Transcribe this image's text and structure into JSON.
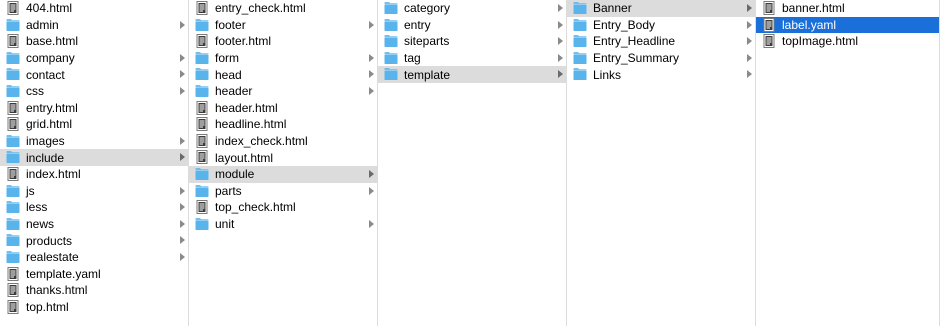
{
  "colors": {
    "folder": "#5ab4ec",
    "selection_active": "#1a6fd8",
    "selection_inactive": "#dcdcdc"
  },
  "columns": [
    {
      "name": "root",
      "items": [
        {
          "label": "404.html",
          "type": "file"
        },
        {
          "label": "admin",
          "type": "folder"
        },
        {
          "label": "base.html",
          "type": "file"
        },
        {
          "label": "company",
          "type": "folder"
        },
        {
          "label": "contact",
          "type": "folder"
        },
        {
          "label": "css",
          "type": "folder"
        },
        {
          "label": "entry.html",
          "type": "file"
        },
        {
          "label": "grid.html",
          "type": "file"
        },
        {
          "label": "images",
          "type": "folder"
        },
        {
          "label": "include",
          "type": "folder",
          "selected": "path"
        },
        {
          "label": "index.html",
          "type": "file"
        },
        {
          "label": "js",
          "type": "folder"
        },
        {
          "label": "less",
          "type": "folder"
        },
        {
          "label": "news",
          "type": "folder"
        },
        {
          "label": "products",
          "type": "folder"
        },
        {
          "label": "realestate",
          "type": "folder"
        },
        {
          "label": "template.yaml",
          "type": "file"
        },
        {
          "label": "thanks.html",
          "type": "file"
        },
        {
          "label": "top.html",
          "type": "file"
        }
      ]
    },
    {
      "name": "include",
      "items": [
        {
          "label": "entry_check.html",
          "type": "file"
        },
        {
          "label": "footer",
          "type": "folder"
        },
        {
          "label": "footer.html",
          "type": "file"
        },
        {
          "label": "form",
          "type": "folder"
        },
        {
          "label": "head",
          "type": "folder"
        },
        {
          "label": "header",
          "type": "folder"
        },
        {
          "label": "header.html",
          "type": "file"
        },
        {
          "label": "headline.html",
          "type": "file"
        },
        {
          "label": "index_check.html",
          "type": "file"
        },
        {
          "label": "layout.html",
          "type": "file"
        },
        {
          "label": "module",
          "type": "folder",
          "selected": "path"
        },
        {
          "label": "parts",
          "type": "folder"
        },
        {
          "label": "top_check.html",
          "type": "file"
        },
        {
          "label": "unit",
          "type": "folder"
        }
      ]
    },
    {
      "name": "module",
      "items": [
        {
          "label": "category",
          "type": "folder"
        },
        {
          "label": "entry",
          "type": "folder"
        },
        {
          "label": "siteparts",
          "type": "folder"
        },
        {
          "label": "tag",
          "type": "folder"
        },
        {
          "label": "template",
          "type": "folder",
          "selected": "path"
        }
      ]
    },
    {
      "name": "template",
      "items": [
        {
          "label": "Banner",
          "type": "folder",
          "selected": "path"
        },
        {
          "label": "Entry_Body",
          "type": "folder"
        },
        {
          "label": "Entry_Headline",
          "type": "folder"
        },
        {
          "label": "Entry_Summary",
          "type": "folder"
        },
        {
          "label": "Links",
          "type": "folder"
        }
      ]
    },
    {
      "name": "Banner",
      "items": [
        {
          "label": "banner.html",
          "type": "file"
        },
        {
          "label": "label.yaml",
          "type": "file",
          "selected": "active"
        },
        {
          "label": "topImage.html",
          "type": "file"
        }
      ]
    }
  ]
}
